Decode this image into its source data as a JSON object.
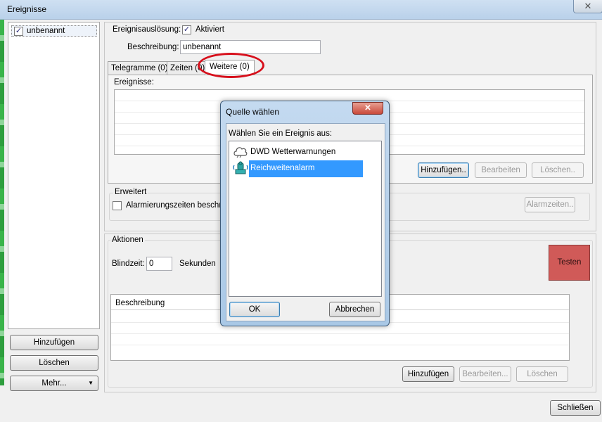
{
  "window": {
    "title": "Ereignisse",
    "close_label": "✕"
  },
  "left_panel": {
    "items": [
      {
        "label": "unbenannt",
        "checked": true
      }
    ],
    "buttons": {
      "add": "Hinzufügen",
      "delete": "Löschen",
      "more": "Mehr..."
    }
  },
  "event_trigger": {
    "label": "Ereignisauslösung:",
    "checkbox_label": "Aktiviert",
    "checked": true
  },
  "description": {
    "label": "Beschreibung:",
    "value": "unbenannt"
  },
  "tabs": [
    {
      "label": "Telegramme (0)"
    },
    {
      "label": "Zeiten (0)"
    },
    {
      "label": "Weitere (0)",
      "active": true
    }
  ],
  "events_group": {
    "label": "Ereignisse:",
    "buttons": {
      "add": "Hinzufügen..",
      "edit": "Bearbeiten",
      "delete": "Löschen.."
    }
  },
  "extended_group": {
    "label": "Erweitert",
    "checkbox_label": "Alarmierungszeiten beschränken",
    "button": "Alarmzeiten.."
  },
  "actions_group": {
    "label": "Aktionen",
    "blind_time_label": "Blindzeit:",
    "blind_time_value": "0",
    "seconds_label": "Sekunden",
    "test_button": "Testen",
    "test_color": "#d05a58",
    "table_header": "Beschreibung",
    "buttons": {
      "add": "Hinzufügen",
      "edit": "Bearbeiten...",
      "delete": "Löschen"
    }
  },
  "close_button": "Schließen",
  "dialog": {
    "title": "Quelle wählen",
    "prompt": "Wählen Sie ein Ereignis aus:",
    "items": [
      {
        "label": "DWD Wetterwarnungen",
        "icon": "cloud-icon",
        "selected": false
      },
      {
        "label": "Reichweitenalarm",
        "icon": "range-alarm-icon",
        "selected": true
      }
    ],
    "ok": "OK",
    "cancel": "Abbrechen"
  },
  "annotation_color": "#d7101c"
}
